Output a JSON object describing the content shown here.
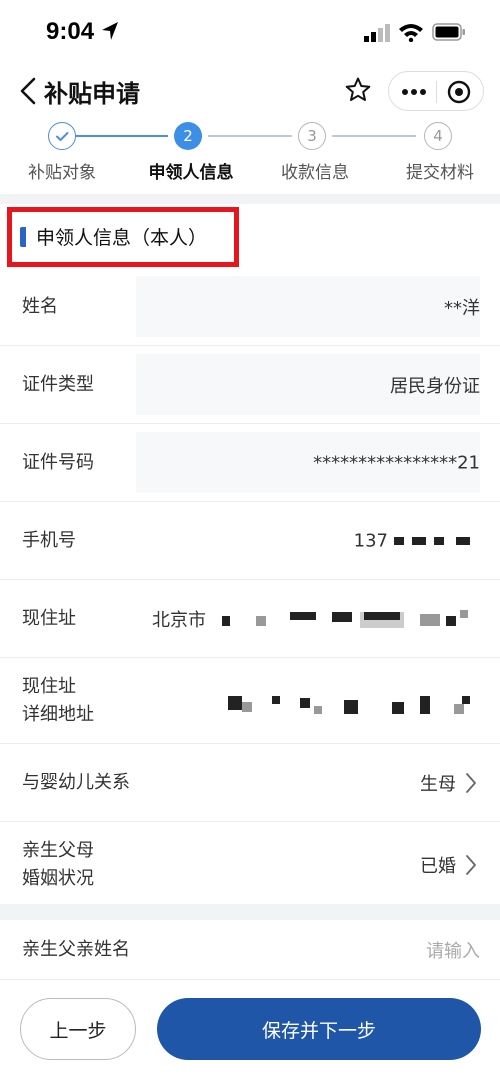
{
  "status_bar": {
    "time": "9:04"
  },
  "nav": {
    "title": "补贴申请"
  },
  "stepper": {
    "steps": [
      {
        "label": "补贴对象",
        "number": "1",
        "state": "done"
      },
      {
        "label": "申领人信息",
        "number": "2",
        "state": "current"
      },
      {
        "label": "收款信息",
        "number": "3",
        "state": "pending"
      },
      {
        "label": "提交材料",
        "number": "4",
        "state": "pending"
      }
    ]
  },
  "section": {
    "title": "申领人信息（本人）"
  },
  "form": {
    "name": {
      "label": "姓名",
      "value": "**洋"
    },
    "id_type": {
      "label": "证件类型",
      "value": "居民身份证"
    },
    "id_number": {
      "label": "证件号码",
      "value": "****************21"
    },
    "phone": {
      "label": "手机号",
      "value": "137"
    },
    "address": {
      "label": "现住址",
      "value": "北京市"
    },
    "address_detail": {
      "label": "现住址\n详细地址"
    },
    "relation": {
      "label": "与婴幼儿关系",
      "value": "生母"
    },
    "marital": {
      "label": "亲生父母\n婚姻状况",
      "value": "已婚"
    },
    "father_name": {
      "label": "亲生父亲姓名",
      "placeholder": "请输入"
    }
  },
  "buttons": {
    "prev": "上一步",
    "next": "保存并下一步"
  },
  "colors": {
    "accent": "#3d8fe6",
    "primary_button": "#1f56a8",
    "highlight_box": "#e6161e"
  }
}
